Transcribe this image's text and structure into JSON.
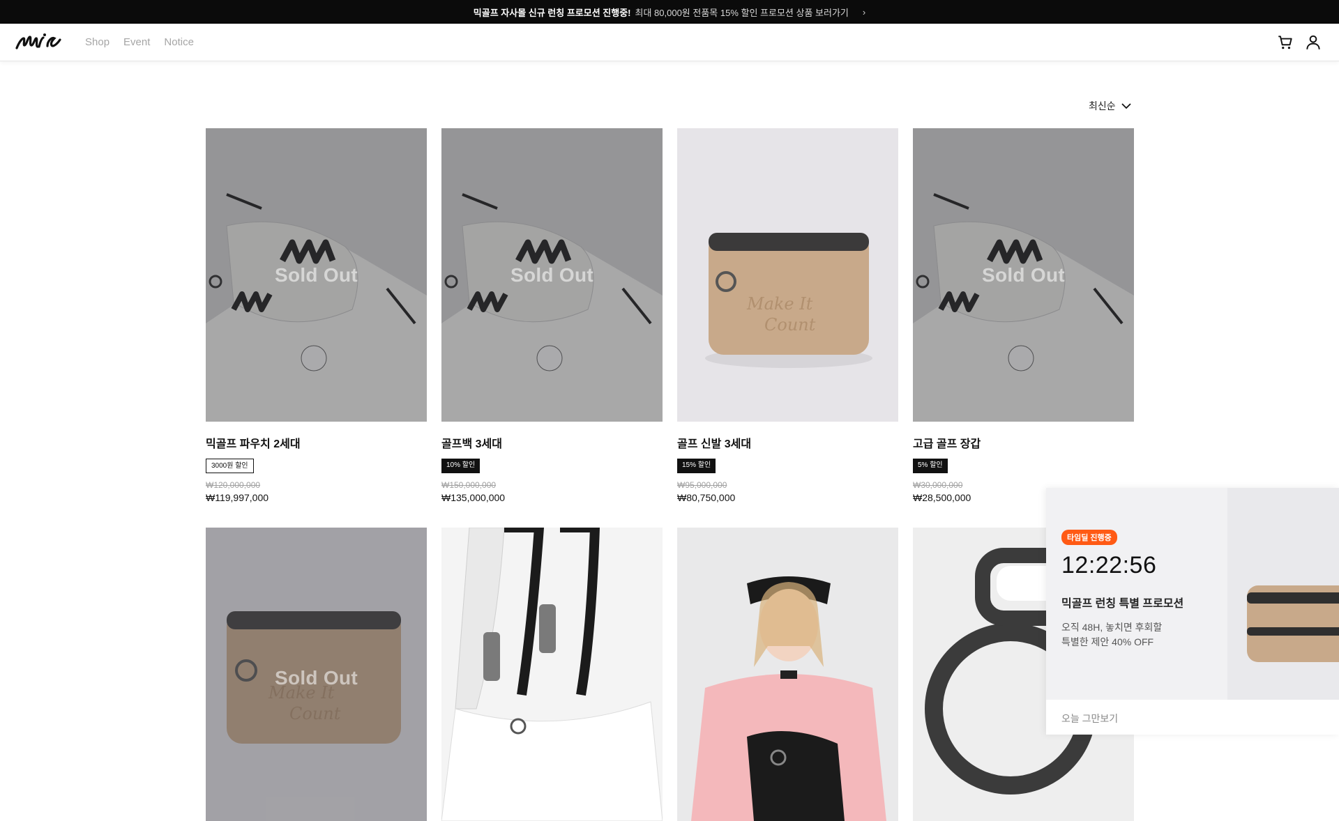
{
  "promo_banner": {
    "strong_text": "믹골프 자사몰 신규 런칭 프로모션 진행중!",
    "text": "최대 80,000원 전품목 15% 할인 프로모션 상품 보러가기",
    "arrow": "›"
  },
  "header": {
    "logo_icon": "mic-logo",
    "nav": [
      "Shop",
      "Event",
      "Notice"
    ],
    "icons": [
      "cart-icon",
      "user-icon"
    ]
  },
  "sort": {
    "label": "최신순",
    "icon": "chevron-down-icon"
  },
  "products_row1": [
    {
      "name": "믹골프 파우치 2세대",
      "badge": "3000원 할인",
      "badge_style": "outline",
      "original_price": "₩120,000,000",
      "price": "₩119,997,000",
      "sold_out": "Sold Out",
      "image": "flatlay-golf-set"
    },
    {
      "name": "골프백 3세대",
      "badge": "10% 할인",
      "badge_style": "dark",
      "original_price": "₩150,000,000",
      "price": "₩135,000,000",
      "sold_out": "Sold Out",
      "image": "flatlay-golf-set"
    },
    {
      "name": "골프 신발 3세대",
      "badge": "15% 할인",
      "badge_style": "dark",
      "original_price": "₩95,000,000",
      "price": "₩80,750,000",
      "sold_out": "",
      "image": "tan-pouch"
    },
    {
      "name": "고급 골프 장갑",
      "badge": "5% 할인",
      "badge_style": "dark",
      "original_price": "₩30,000,000",
      "price": "₩28,500,000",
      "sold_out": "Sold Out",
      "image": "flatlay-golf-set"
    }
  ],
  "products_row2": [
    {
      "sold_out": "Sold Out",
      "image": "tan-pouch"
    },
    {
      "sold_out": "",
      "image": "white-bag-zipper"
    },
    {
      "sold_out": "",
      "image": "woman-pink-polo"
    },
    {
      "sold_out": "",
      "image": "metal-ring-closeup"
    }
  ],
  "popup": {
    "badge": "타임딜 진행중",
    "timer": "12:22:56",
    "title": "믹골프 런칭 특별 프로모션",
    "desc_line1": "오직 48H, 놓치면 후회할",
    "desc_line2": "특별한 제안 40% OFF",
    "close_label": "오늘 그만보기",
    "badge_color": "#ff5a14"
  }
}
